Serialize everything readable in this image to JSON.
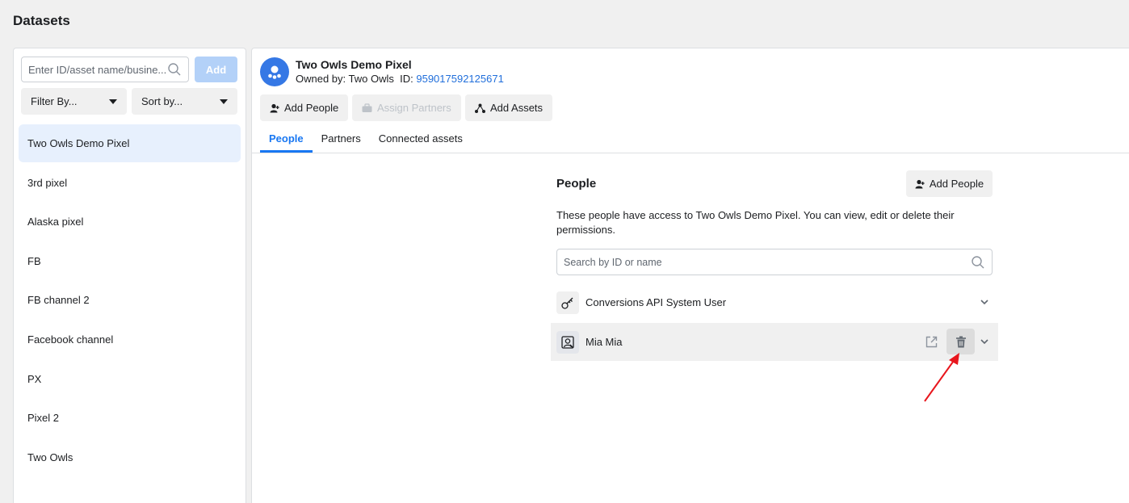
{
  "page": {
    "title": "Datasets"
  },
  "sidebar": {
    "search_placeholder": "Enter ID/asset name/busine...",
    "add_label": "Add",
    "filter_label": "Filter By...",
    "sort_label": "Sort by...",
    "items": [
      {
        "label": "Two Owls Demo Pixel"
      },
      {
        "label": "3rd pixel"
      },
      {
        "label": "Alaska pixel"
      },
      {
        "label": "FB"
      },
      {
        "label": "FB channel 2"
      },
      {
        "label": "Facebook channel"
      },
      {
        "label": "PX"
      },
      {
        "label": "Pixel 2"
      },
      {
        "label": "Two Owls"
      }
    ]
  },
  "detail": {
    "name": "Two Owls Demo Pixel",
    "owned_prefix": "Owned by: Two Owls",
    "id_prefix": "ID:",
    "id_value": "959017592125671",
    "actions": {
      "add_people": "Add People",
      "assign_partners": "Assign Partners",
      "add_assets": "Add Assets"
    },
    "tabs": [
      {
        "label": "People"
      },
      {
        "label": "Partners"
      },
      {
        "label": "Connected assets"
      }
    ]
  },
  "people": {
    "title": "People",
    "add_label": "Add People",
    "description": "These people have access to Two Owls Demo Pixel. You can view, edit or delete their permissions.",
    "search_placeholder": "Search by ID or name",
    "rows": [
      {
        "name": "Conversions API System User",
        "icon": "key-icon"
      },
      {
        "name": "Mia Mia",
        "icon": "person-badge-icon"
      }
    ]
  },
  "colors": {
    "accent": "#1877f2",
    "selected_bg": "#e7f0fd",
    "annotation_arrow": "#e8161d"
  }
}
